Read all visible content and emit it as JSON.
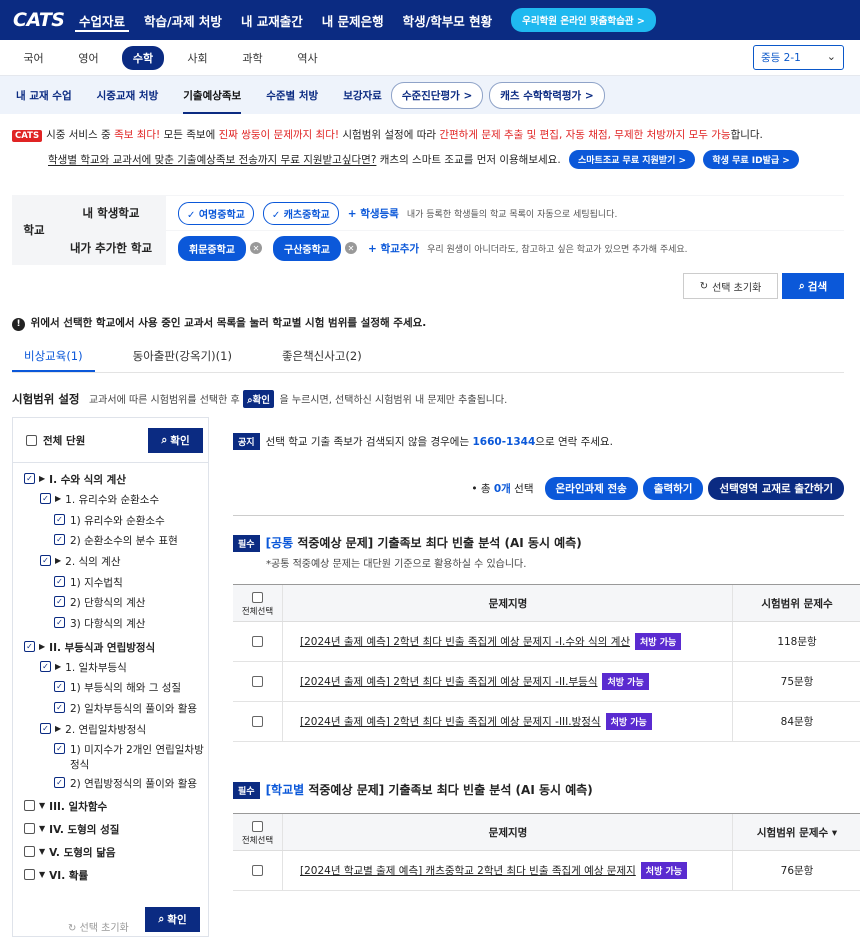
{
  "header": {
    "logo": "CATS",
    "nav": [
      "수업자료",
      "학습/과제 처방",
      "내 교재출간",
      "내 문제은행",
      "학생/학부모 현황"
    ],
    "active_nav": 0,
    "promo": "우리학원 온라인 맞춤학습관 >"
  },
  "subjects": {
    "items": [
      "국어",
      "영어",
      "수학",
      "사회",
      "과학",
      "역사"
    ],
    "active": 2,
    "grade": "중등 2-1"
  },
  "subtabs": {
    "items": [
      "내 교재 수업",
      "시중교재 처방",
      "기출예상족보",
      "수준별 처방",
      "보강자료"
    ],
    "active": 2,
    "pills": [
      "수준진단평가 >",
      "캐츠 수학학력평가 >"
    ]
  },
  "notice": {
    "badge": "CATS",
    "line1_a": "시중 서비스 중 ",
    "line1_b": "족보 최다!",
    "line1_c": " 모든 족보에 ",
    "line1_d": "진짜 쌍둥이 문제까지 최다!",
    "line1_e": " 시험범위 설정에 따라 ",
    "line1_f": "간편하게 문제 추출 및 편집, 자동 채점, 무제한 처방까지 모두 가능",
    "line1_g": "합니다.",
    "line2": "학생별 학교와 교과서에 맞춘 기출예상족보 전송까지 무료 지원받고싶다면?",
    "line2_b": " 캐츠의 스마트 조교를 먼저 이용해보세요.",
    "btn1": "스마트조교 무료 지원받기 >",
    "btn2": "학생 무료 ID발급 >"
  },
  "school": {
    "label": "학교",
    "my_label": "내 학생학교",
    "my_schools": [
      "✓ 여명중학교",
      "✓ 캐츠중학교"
    ],
    "my_add": "+ 학생등록",
    "my_hint": "내가 등록한 학생들의 학교 목록이 자동으로 세팅됩니다.",
    "added_label": "내가 추가한 학교",
    "added_schools": [
      "휘문중학교",
      "구산중학교"
    ],
    "added_add": "+ 학교추가",
    "added_hint": "우리 원생이 아니더라도, 참고하고 싶은 학교가 있으면 추가해 주세요.",
    "reset": "선택 초기화",
    "search": "검색"
  },
  "warning": "위에서 선택한 학교에서 사용 중인 교과서 목록을 눌러 학교별 시험 범위를 설정해 주세요.",
  "book_tabs": {
    "items": [
      "비상교육(1)",
      "동아출판(강옥기)(1)",
      "좋은책신사고(2)"
    ],
    "active": 0
  },
  "range": {
    "title": "시험범위 설정",
    "desc_a": "교과서에 따른 시험범위를 선택한 후",
    "desc_btn": "확인",
    "desc_b": "을 누르시면, 선택하신 시험범위 내 문제만 추출됩니다."
  },
  "tree": {
    "all": "전체 단원",
    "ok": "확인",
    "reset": "선택 초기화",
    "nodes": [
      {
        "label": "I. 수와 식의 계산",
        "checked": true,
        "arrow": "▶"
      },
      {
        "label": "1. 유리수와 순환소수",
        "checked": true,
        "arrow": "▶"
      },
      {
        "label": "1) 유리수와 순환소수",
        "checked": true
      },
      {
        "label": "2) 순환소수의 분수 표현",
        "checked": true
      },
      {
        "label": "2. 식의 계산",
        "checked": true,
        "arrow": "▶"
      },
      {
        "label": "1) 지수법칙",
        "checked": true
      },
      {
        "label": "2) 단항식의 계산",
        "checked": true
      },
      {
        "label": "3) 다항식의 계산",
        "checked": true
      },
      {
        "label": "II. 부등식과 연립방정식",
        "checked": true,
        "arrow": "▶"
      },
      {
        "label": "1. 일차부등식",
        "checked": true,
        "arrow": "▶"
      },
      {
        "label": "1) 부등식의 해와 그 성질",
        "checked": true
      },
      {
        "label": "2) 일차부등식의 풀이와 활용",
        "checked": true
      },
      {
        "label": "2. 연립일차방정식",
        "checked": true,
        "arrow": "▶"
      },
      {
        "label": "1) 미지수가 2개인 연립일차방",
        "checked": true
      },
      {
        "label": "정식",
        "checked": null
      },
      {
        "label": "2) 연립방정식의 풀이와 활용",
        "checked": true
      },
      {
        "label": "III. 일차함수",
        "checked": false,
        "arrow": "▼"
      },
      {
        "label": "IV. 도형의 성질",
        "checked": false,
        "arrow": "▼"
      },
      {
        "label": "V. 도형의 닮음",
        "checked": false,
        "arrow": "▼"
      },
      {
        "label": "VI. 확률",
        "checked": false,
        "arrow": "▼"
      }
    ]
  },
  "public_notice": {
    "tag": "공지",
    "text_a": "선택 학교 기출 족보가 검색되지 않을 경우에는 ",
    "phone": "1660-1344",
    "text_b": "으로 연락 주세요."
  },
  "summary": {
    "prefix": "• 총 ",
    "count": "0개",
    "suffix": " 선택",
    "btn1": "온라인과제 전송",
    "btn2": "출력하기",
    "btn3": "선택영역 교재로 출간하기"
  },
  "section1": {
    "tag": "필수",
    "title_blue": "[공통",
    "title_rest": " 적중예상 문제] 기출족보 최다 빈출 분석 (AI 동시 예측)",
    "note": "*공통 적중예상 문제는 대단원 기준으로 활용하실 수 있습니다.",
    "col_all": "전체선택",
    "col_name": "문제지명",
    "col_count": "시험범위 문제수",
    "rows": [
      {
        "name": "[2024년 출제 예측] 2학년 최다 빈출 족집게 예상 문제지 -I.수와 식의 계산",
        "badge": "처방 가능",
        "count": "118문항"
      },
      {
        "name": "[2024년 출제 예측] 2학년 최다 빈출 족집게 예상 문제지 -II.부등식",
        "badge": "처방 가능",
        "count": "75문항"
      },
      {
        "name": "[2024년 출제 예측] 2학년 최다 빈출 족집게 예상 문제지 -III.방정식",
        "badge": "처방 가능",
        "count": "84문항"
      }
    ]
  },
  "section2": {
    "tag": "필수",
    "title_blue": "[학교별",
    "title_rest": " 적중예상 문제] 기출족보 최다 빈출 분석 (AI 동시 예측)",
    "col_all": "전체선택",
    "col_name": "문제지명",
    "col_count": "시험범위 문제수 ▾",
    "rows": [
      {
        "name": "[2024년 학교별 출제 예측] 캐츠중학교 2학년 최다 빈출 족집게 예상 문제지",
        "badge": "처방 가능",
        "count": "76문항"
      }
    ]
  },
  "colors": {
    "navy": "#0b2b82",
    "blue": "#0b58d9",
    "red": "#e02424",
    "purple": "#5a2bd0",
    "cyan": "#1fb9f0"
  }
}
